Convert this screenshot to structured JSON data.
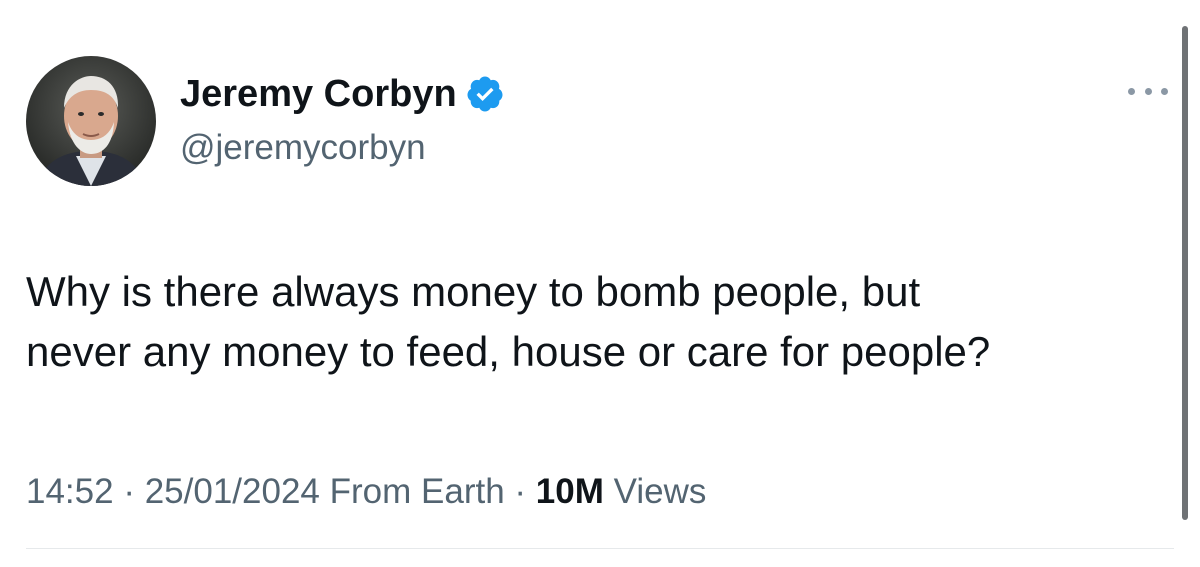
{
  "author": {
    "display_name": "Jeremy Corbyn",
    "handle": "@jeremycorbyn",
    "verified_icon": "verified-badge-icon",
    "verified_color": "#1d9bf0"
  },
  "tweet": {
    "text_lines": [
      "Why is there always money to bomb people, but",
      "never any money to feed, house or care for people?"
    ]
  },
  "meta": {
    "time": "14:52",
    "date": "25/01/2024",
    "source": "From Earth",
    "separator": "·",
    "views_count": "10M",
    "views_label": "Views"
  },
  "menu": {
    "icon": "more-options-icon"
  }
}
